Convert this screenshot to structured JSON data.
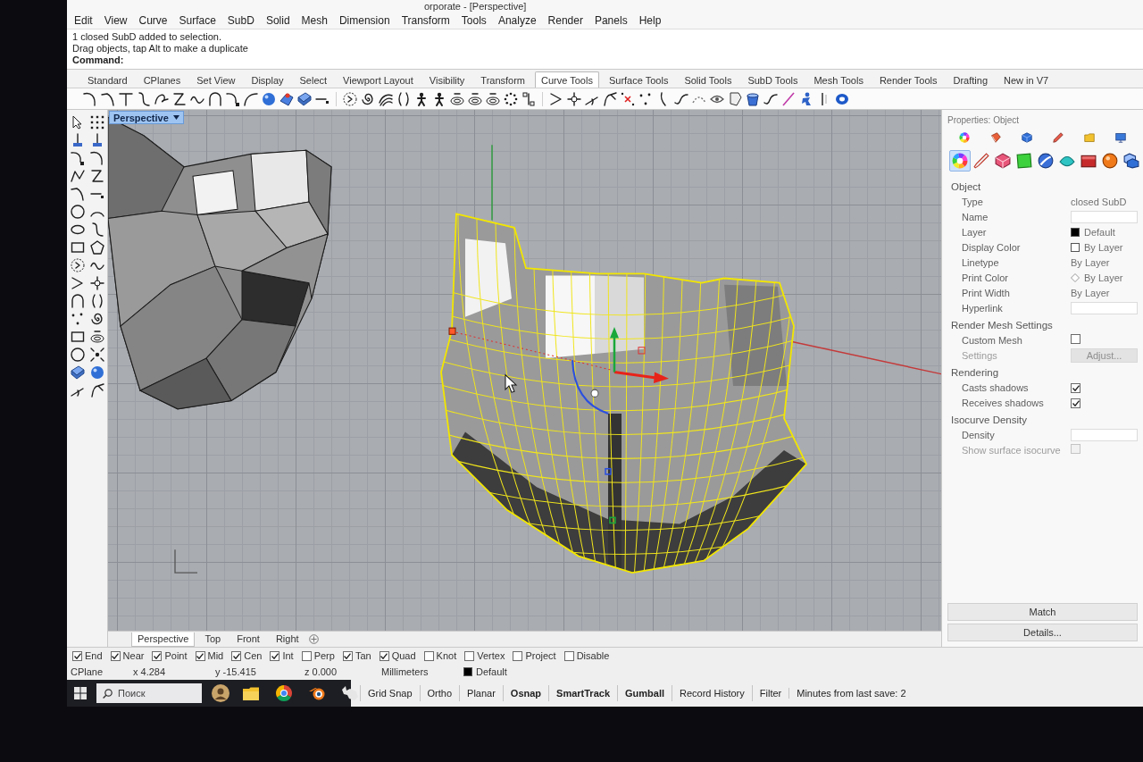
{
  "window": {
    "title": "orporate - [Perspective]"
  },
  "menu": [
    "Edit",
    "View",
    "Curve",
    "Surface",
    "SubD",
    "Solid",
    "Mesh",
    "Dimension",
    "Transform",
    "Tools",
    "Analyze",
    "Render",
    "Panels",
    "Help"
  ],
  "command_history": [
    "1 closed SubD added to selection.",
    "Drag objects, tap Alt to make a duplicate"
  ],
  "command": {
    "prompt": "Command:"
  },
  "toolbar_tabs": [
    {
      "label": "Standard",
      "selected": false
    },
    {
      "label": "CPlanes",
      "selected": false
    },
    {
      "label": "Set View",
      "selected": false
    },
    {
      "label": "Display",
      "selected": false
    },
    {
      "label": "Select",
      "selected": false
    },
    {
      "label": "Viewport Layout",
      "selected": false
    },
    {
      "label": "Visibility",
      "selected": false
    },
    {
      "label": "Transform",
      "selected": false
    },
    {
      "label": "Curve Tools",
      "selected": true
    },
    {
      "label": "Surface Tools",
      "selected": false
    },
    {
      "label": "Solid Tools",
      "selected": false
    },
    {
      "label": "SubD Tools",
      "selected": false
    },
    {
      "label": "Mesh Tools",
      "selected": false
    },
    {
      "label": "Render Tools",
      "selected": false
    },
    {
      "label": "Drafting",
      "selected": false
    },
    {
      "label": "New in V7",
      "selected": false
    }
  ],
  "viewport": {
    "label": "Perspective"
  },
  "viewport_tabs": [
    {
      "label": "Perspective",
      "selected": true
    },
    {
      "label": "Top",
      "selected": false
    },
    {
      "label": "Front",
      "selected": false
    },
    {
      "label": "Right",
      "selected": false
    }
  ],
  "osnaps": [
    {
      "label": "End",
      "checked": true
    },
    {
      "label": "Near",
      "checked": true
    },
    {
      "label": "Point",
      "checked": true
    },
    {
      "label": "Mid",
      "checked": true
    },
    {
      "label": "Cen",
      "checked": true
    },
    {
      "label": "Int",
      "checked": true
    },
    {
      "label": "Perp",
      "checked": false
    },
    {
      "label": "Tan",
      "checked": true
    },
    {
      "label": "Quad",
      "checked": true
    },
    {
      "label": "Knot",
      "checked": false
    },
    {
      "label": "Vertex",
      "checked": false
    },
    {
      "label": "Project",
      "checked": false
    },
    {
      "label": "Disable",
      "checked": false
    }
  ],
  "coordinates": {
    "plane": "CPlane",
    "x": "x 4.284",
    "y": "y -15.415",
    "z": "z 0.000",
    "units": "Millimeters",
    "layer": {
      "name": "Default",
      "color": "#000000"
    }
  },
  "taskbar": {
    "search": {
      "placeholder": "Поиск"
    }
  },
  "status_toggles": [
    {
      "label": "Grid Snap",
      "on": false
    },
    {
      "label": "Ortho",
      "on": false
    },
    {
      "label": "Planar",
      "on": false
    },
    {
      "label": "Osnap",
      "on": true
    },
    {
      "label": "SmartTrack",
      "on": true
    },
    {
      "label": "Gumball",
      "on": true
    },
    {
      "label": "Record History",
      "on": false
    },
    {
      "label": "Filter",
      "on": false
    }
  ],
  "status_text": "Minutes from last save: 2",
  "properties": {
    "title": "Properties: Object",
    "tab_rows": [
      [
        {
          "kind": "wheel",
          "selected": false
        },
        {
          "kind": "bucket",
          "selected": false
        },
        {
          "kind": "cube",
          "selected": false
        },
        {
          "kind": "pencil",
          "selected": false
        },
        {
          "kind": "folder",
          "selected": false
        },
        {
          "kind": "monitor",
          "selected": false
        }
      ],
      [
        {
          "kind": "wheel",
          "selected": true
        },
        {
          "kind": "dropper",
          "selected": false
        },
        {
          "kind": "box",
          "selected": false
        },
        {
          "kind": "sheet",
          "selected": false
        },
        {
          "kind": "globe",
          "selected": false
        },
        {
          "kind": "gem",
          "selected": false
        },
        {
          "kind": "panel",
          "selected": false
        },
        {
          "kind": "ball",
          "selected": false
        },
        {
          "kind": "cubes",
          "selected": false
        }
      ]
    ],
    "sections": [
      {
        "title": "Object",
        "rows": [
          {
            "label": "Type",
            "kind": "text",
            "value": "closed SubD",
            "disabled": false
          },
          {
            "label": "Name",
            "kind": "field",
            "disabled": false
          },
          {
            "label": "Layer",
            "kind": "swatch",
            "value": "Default",
            "color": "#000000",
            "disabled": false
          },
          {
            "label": "Display Color",
            "kind": "swatch",
            "value": "By Layer",
            "color": "#ffffff",
            "disabled": false
          },
          {
            "label": "Linetype",
            "kind": "text",
            "value": "By Layer",
            "disabled": false
          },
          {
            "label": "Print Color",
            "kind": "diamond",
            "value": "By Layer",
            "disabled": false
          },
          {
            "label": "Print Width",
            "kind": "text",
            "value": "By Layer",
            "disabled": false
          },
          {
            "label": "Hyperlink",
            "kind": "field",
            "disabled": false
          }
        ]
      },
      {
        "title": "Render Mesh Settings",
        "rows": [
          {
            "label": "Custom Mesh",
            "kind": "checkbox",
            "checked": false,
            "disabled": false
          },
          {
            "label": "Settings",
            "kind": "button",
            "value": "Adjust...",
            "disabled": true
          }
        ]
      },
      {
        "title": "Rendering",
        "rows": [
          {
            "label": "Casts shadows",
            "kind": "checkbox",
            "checked": true,
            "disabled": false
          },
          {
            "label": "Receives shadows",
            "kind": "checkbox",
            "checked": true,
            "disabled": false
          }
        ]
      },
      {
        "title": "Isocurve Density",
        "rows": [
          {
            "label": "Density",
            "kind": "field",
            "disabled": false
          },
          {
            "label": "Show surface isocurve",
            "kind": "checkbox",
            "checked": false,
            "disabled": true
          }
        ]
      }
    ],
    "buttons": [
      "Match",
      "Details..."
    ]
  }
}
